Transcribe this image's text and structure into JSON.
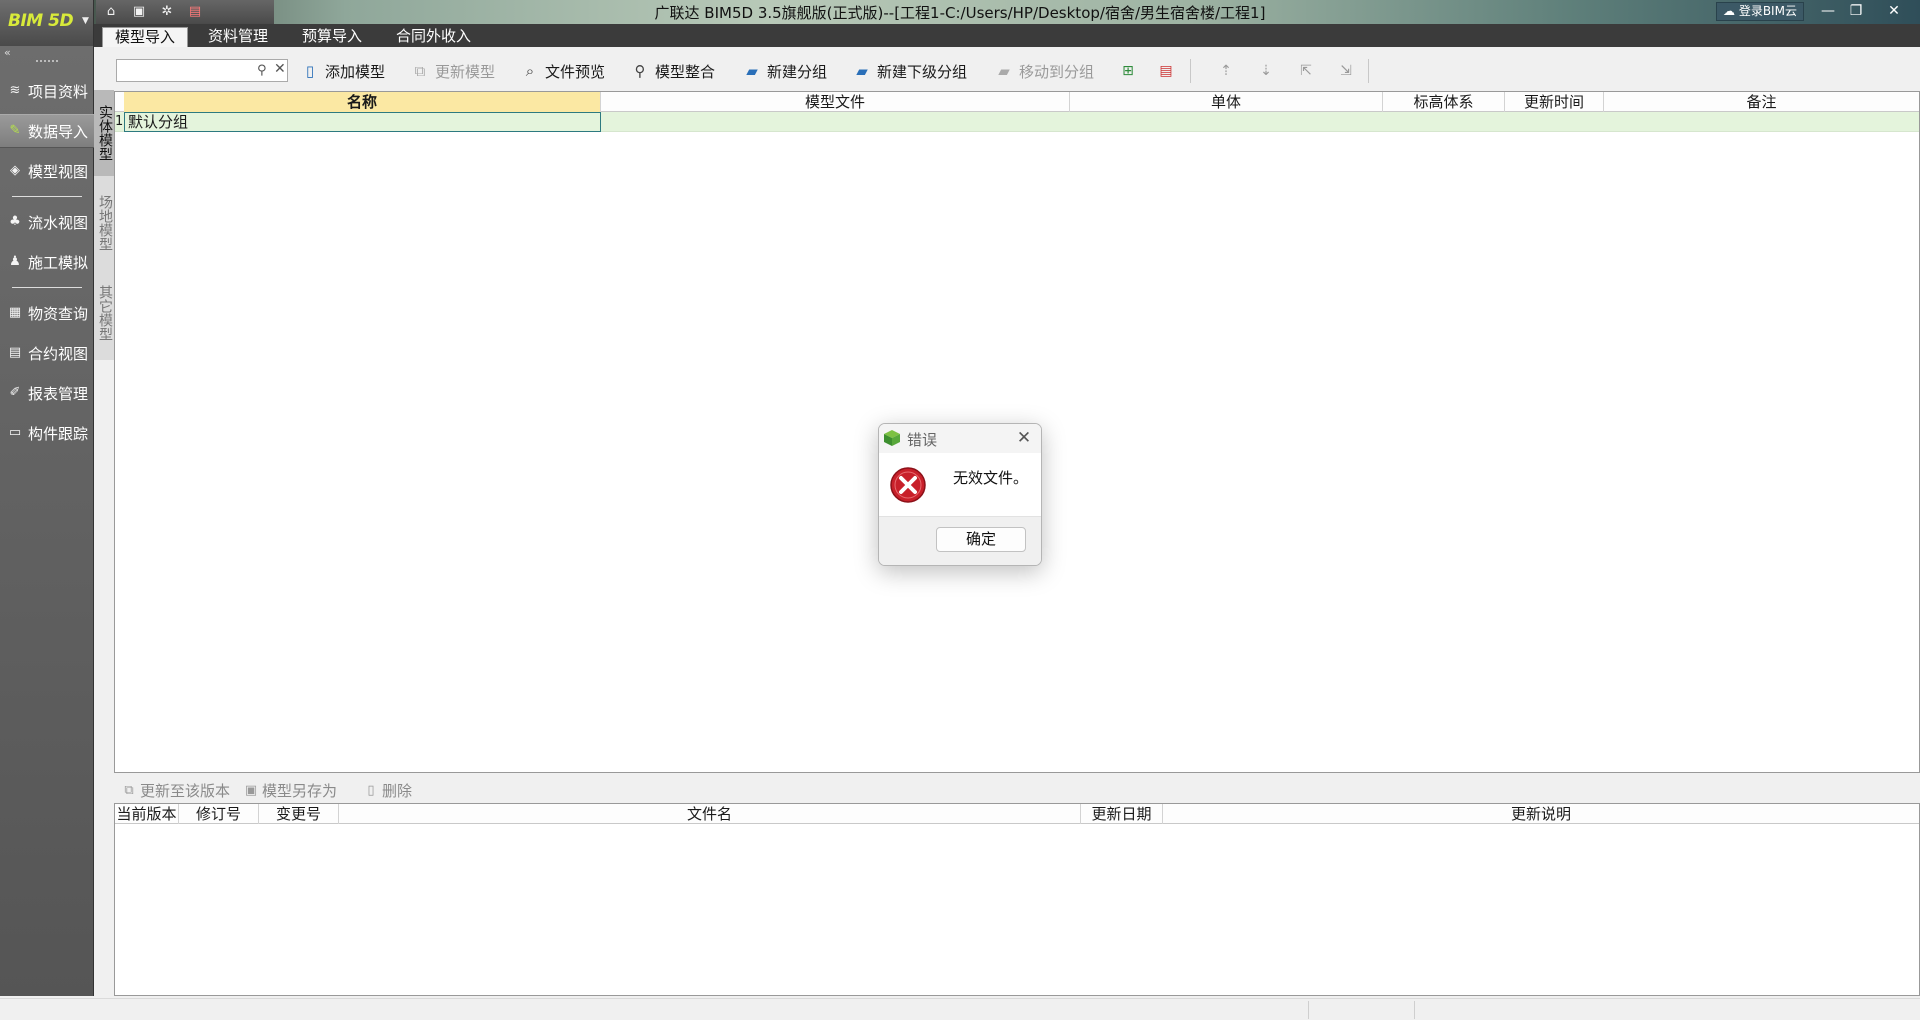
{
  "app": {
    "logo_text": "BIM 5D",
    "window_title": "广联达 BIM5D 3.5旗舰版(正式版)--[工程1-C:/Users/HP/Desktop/宿舍/男生宿舍楼/工程1]",
    "cloud_login": "登录BIM云"
  },
  "tabs": [
    {
      "label": "模型导入",
      "active": true
    },
    {
      "label": "资料管理"
    },
    {
      "label": "预算导入"
    },
    {
      "label": "合同外收入"
    }
  ],
  "sidebar": {
    "items": [
      {
        "label": "项目资料",
        "icon": "stack-icon"
      },
      {
        "label": "数据导入",
        "icon": "import-icon",
        "active": true
      },
      {
        "label": "模型视图",
        "icon": "model-icon"
      },
      {
        "label": "流水视图",
        "icon": "flow-icon"
      },
      {
        "label": "施工模拟",
        "icon": "worker-icon"
      },
      {
        "label": "物资查询",
        "icon": "materials-icon"
      },
      {
        "label": "合约视图",
        "icon": "contract-icon"
      },
      {
        "label": "报表管理",
        "icon": "report-icon"
      },
      {
        "label": "构件跟踪",
        "icon": "monitor-icon"
      }
    ]
  },
  "model_tabs": [
    {
      "label": "实体模型",
      "active": true
    },
    {
      "label": "场地模型"
    },
    {
      "label": "其它模型"
    }
  ],
  "toolbar": {
    "search_value": "",
    "search_placeholder": "",
    "add_model": "添加模型",
    "update_model": "更新模型",
    "file_preview": "文件预览",
    "model_merge": "模型整合",
    "new_group": "新建分组",
    "new_subgroup": "新建下级分组",
    "move_to_group": "移动到分组"
  },
  "grid": {
    "columns": [
      "名称",
      "模型文件",
      "单体",
      "标高体系",
      "更新时间",
      "备注"
    ],
    "rows": [
      {
        "num": "1",
        "name": "默认分组",
        "file": "",
        "unit": "",
        "elevation": "",
        "time": "",
        "note": ""
      }
    ]
  },
  "versions": {
    "toolbar": {
      "update_to_version": "更新至该版本",
      "save_model_as": "模型另存为",
      "delete": "删除"
    },
    "columns": [
      "当前版本",
      "修订号",
      "变更号",
      "文件名",
      "更新日期",
      "更新说明"
    ]
  },
  "dialog": {
    "title": "错误",
    "message": "无效文件。",
    "ok": "确定"
  },
  "colors": {
    "selected_header": "#fbe8a3",
    "row_bg": "#e4f4dc",
    "sidebar_bg": "#555555",
    "error_red": "#c8202a"
  }
}
